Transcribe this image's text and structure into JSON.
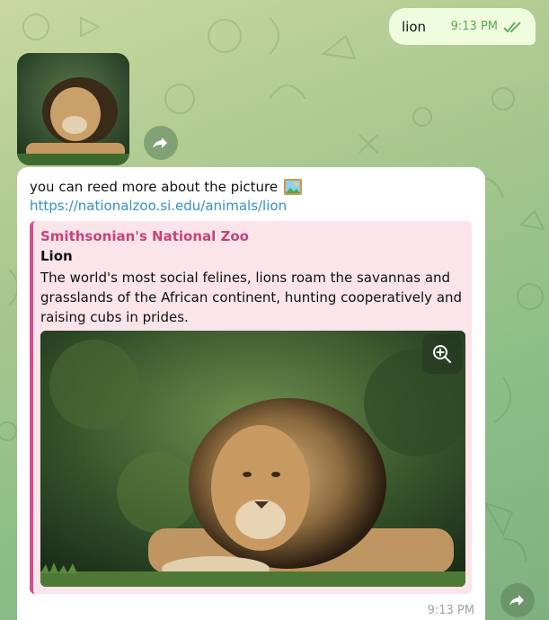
{
  "outgoing": {
    "text": "lion",
    "time": "9:13 PM",
    "status_icon": "double-check-icon"
  },
  "photo_message": {
    "image_alt": "lion photo thumbnail",
    "forward_icon": "forward-icon"
  },
  "incoming": {
    "text": "you can reed more about the picture",
    "emoji_icon": "framed-picture-icon",
    "link": "https://nationalzoo.si.edu/animals/lion",
    "time": "9:13 PM",
    "preview": {
      "site": "Smithsonian's National Zoo",
      "title": "Lion",
      "description": "The world's most social felines, lions roam the savannas and grasslands of the African continent, hunting cooperatively and raising cubs in prides.",
      "zoom_icon": "zoom-in-icon"
    }
  },
  "colors": {
    "out_bubble": "#effdde",
    "link": "#3390c7",
    "preview_accent": "#d24f88",
    "preview_bg": "#fbe4ea"
  }
}
